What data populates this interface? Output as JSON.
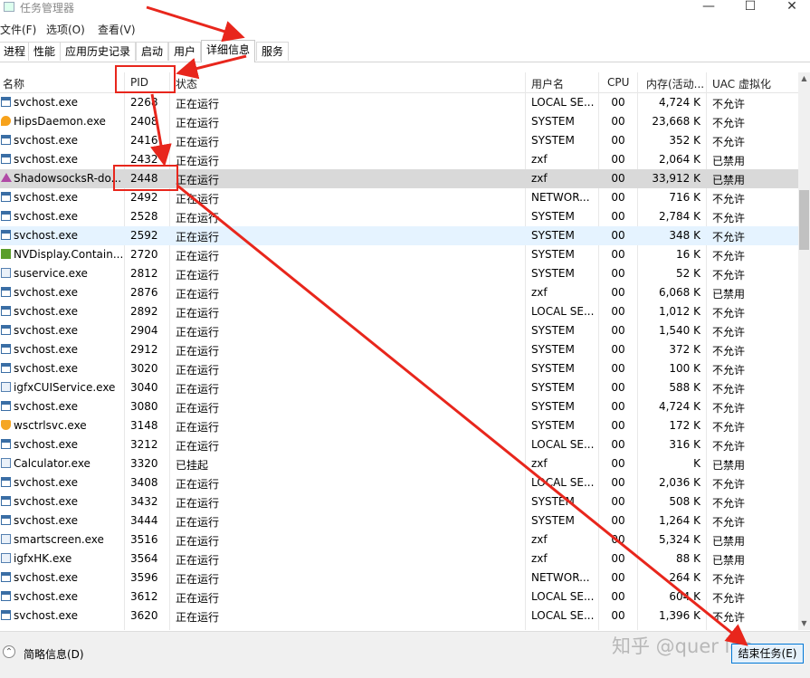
{
  "window": {
    "title": "任务管理器",
    "controls": [
      "—",
      "☐",
      "✕"
    ]
  },
  "menu": [
    "文件(F)",
    "选项(O)",
    "查看(V)"
  ],
  "tabs": [
    "进程",
    "性能",
    "应用历史记录",
    "启动",
    "用户",
    "详细信息",
    "服务"
  ],
  "active_tab": "详细信息",
  "columns": {
    "name": "名称",
    "pid": "PID",
    "status": "状态",
    "user": "用户名",
    "cpu": "CPU",
    "mem": "内存(活动...",
    "uac": "UAC 虚拟化"
  },
  "sort_indicator": "^",
  "rows": [
    {
      "icon": "service-icon",
      "name": "svchost.exe",
      "pid": "2268",
      "status": "正在运行",
      "user": "LOCAL SE...",
      "cpu": "00",
      "mem": "4,724 K",
      "uac": "不允许"
    },
    {
      "icon": "hips-icon",
      "name": "HipsDaemon.exe",
      "pid": "2408",
      "status": "正在运行",
      "user": "SYSTEM",
      "cpu": "00",
      "mem": "23,668 K",
      "uac": "不允许"
    },
    {
      "icon": "service-icon",
      "name": "svchost.exe",
      "pid": "2416",
      "status": "正在运行",
      "user": "SYSTEM",
      "cpu": "00",
      "mem": "352 K",
      "uac": "不允许"
    },
    {
      "icon": "service-icon",
      "name": "svchost.exe",
      "pid": "2432",
      "status": "正在运行",
      "user": "zxf",
      "cpu": "00",
      "mem": "2,064 K",
      "uac": "已禁用"
    },
    {
      "icon": "shadowsocks-icon",
      "name": "ShadowsocksR-do...",
      "pid": "2448",
      "status": "正在运行",
      "user": "zxf",
      "cpu": "00",
      "mem": "33,912 K",
      "uac": "已禁用",
      "state": "selected"
    },
    {
      "icon": "service-icon",
      "name": "svchost.exe",
      "pid": "2492",
      "status": "正在运行",
      "user": "NETWOR...",
      "cpu": "00",
      "mem": "716 K",
      "uac": "不允许"
    },
    {
      "icon": "service-icon",
      "name": "svchost.exe",
      "pid": "2528",
      "status": "正在运行",
      "user": "SYSTEM",
      "cpu": "00",
      "mem": "2,784 K",
      "uac": "不允许"
    },
    {
      "icon": "service-icon",
      "name": "svchost.exe",
      "pid": "2592",
      "status": "正在运行",
      "user": "SYSTEM",
      "cpu": "00",
      "mem": "348 K",
      "uac": "不允许",
      "state": "hover"
    },
    {
      "icon": "nvidia-icon",
      "name": "NVDisplay.Contain...",
      "pid": "2720",
      "status": "正在运行",
      "user": "SYSTEM",
      "cpu": "00",
      "mem": "16 K",
      "uac": "不允许"
    },
    {
      "icon": "app-icon",
      "name": "suservice.exe",
      "pid": "2812",
      "status": "正在运行",
      "user": "SYSTEM",
      "cpu": "00",
      "mem": "52 K",
      "uac": "不允许"
    },
    {
      "icon": "service-icon",
      "name": "svchost.exe",
      "pid": "2876",
      "status": "正在运行",
      "user": "zxf",
      "cpu": "00",
      "mem": "6,068 K",
      "uac": "已禁用"
    },
    {
      "icon": "service-icon",
      "name": "svchost.exe",
      "pid": "2892",
      "status": "正在运行",
      "user": "LOCAL SE...",
      "cpu": "00",
      "mem": "1,012 K",
      "uac": "不允许"
    },
    {
      "icon": "service-icon",
      "name": "svchost.exe",
      "pid": "2904",
      "status": "正在运行",
      "user": "SYSTEM",
      "cpu": "00",
      "mem": "1,540 K",
      "uac": "不允许"
    },
    {
      "icon": "service-icon",
      "name": "svchost.exe",
      "pid": "2912",
      "status": "正在运行",
      "user": "SYSTEM",
      "cpu": "00",
      "mem": "372 K",
      "uac": "不允许"
    },
    {
      "icon": "service-icon",
      "name": "svchost.exe",
      "pid": "3020",
      "status": "正在运行",
      "user": "SYSTEM",
      "cpu": "00",
      "mem": "100 K",
      "uac": "不允许"
    },
    {
      "icon": "app-icon",
      "name": "igfxCUIService.exe",
      "pid": "3040",
      "status": "正在运行",
      "user": "SYSTEM",
      "cpu": "00",
      "mem": "588 K",
      "uac": "不允许"
    },
    {
      "icon": "service-icon",
      "name": "svchost.exe",
      "pid": "3080",
      "status": "正在运行",
      "user": "SYSTEM",
      "cpu": "00",
      "mem": "4,724 K",
      "uac": "不允许"
    },
    {
      "icon": "shield-icon",
      "name": "wsctrlsvc.exe",
      "pid": "3148",
      "status": "正在运行",
      "user": "SYSTEM",
      "cpu": "00",
      "mem": "172 K",
      "uac": "不允许"
    },
    {
      "icon": "service-icon",
      "name": "svchost.exe",
      "pid": "3212",
      "status": "正在运行",
      "user": "LOCAL SE...",
      "cpu": "00",
      "mem": "316 K",
      "uac": "不允许"
    },
    {
      "icon": "app-icon",
      "name": "Calculator.exe",
      "pid": "3320",
      "status": "已挂起",
      "user": "zxf",
      "cpu": "00",
      "mem": "K",
      "uac": "已禁用"
    },
    {
      "icon": "service-icon",
      "name": "svchost.exe",
      "pid": "3408",
      "status": "正在运行",
      "user": "LOCAL SE...",
      "cpu": "00",
      "mem": "2,036 K",
      "uac": "不允许"
    },
    {
      "icon": "service-icon",
      "name": "svchost.exe",
      "pid": "3432",
      "status": "正在运行",
      "user": "SYSTEM",
      "cpu": "00",
      "mem": "508 K",
      "uac": "不允许"
    },
    {
      "icon": "service-icon",
      "name": "svchost.exe",
      "pid": "3444",
      "status": "正在运行",
      "user": "SYSTEM",
      "cpu": "00",
      "mem": "1,264 K",
      "uac": "不允许"
    },
    {
      "icon": "app-icon",
      "name": "smartscreen.exe",
      "pid": "3516",
      "status": "正在运行",
      "user": "zxf",
      "cpu": "00",
      "mem": "5,324 K",
      "uac": "已禁用"
    },
    {
      "icon": "app-icon",
      "name": "igfxHK.exe",
      "pid": "3564",
      "status": "正在运行",
      "user": "zxf",
      "cpu": "00",
      "mem": "88 K",
      "uac": "已禁用"
    },
    {
      "icon": "service-icon",
      "name": "svchost.exe",
      "pid": "3596",
      "status": "正在运行",
      "user": "NETWOR...",
      "cpu": "00",
      "mem": "264 K",
      "uac": "不允许"
    },
    {
      "icon": "service-icon",
      "name": "svchost.exe",
      "pid": "3612",
      "status": "正在运行",
      "user": "LOCAL SE...",
      "cpu": "00",
      "mem": "604 K",
      "uac": "不允许"
    },
    {
      "icon": "service-icon",
      "name": "svchost.exe",
      "pid": "3620",
      "status": "正在运行",
      "user": "LOCAL SE...",
      "cpu": "00",
      "mem": "1,396 K",
      "uac": "不允许"
    }
  ],
  "footer": {
    "brief_label": "简略信息(D)",
    "end_task_label": "结束任务(E)",
    "watermark": "知乎 @quer lee"
  },
  "colors": {
    "annotation_red": "#e8261c",
    "selected_row": "#d9d9d9",
    "hover_row": "#e5f3ff",
    "button_border": "#0078d7"
  }
}
